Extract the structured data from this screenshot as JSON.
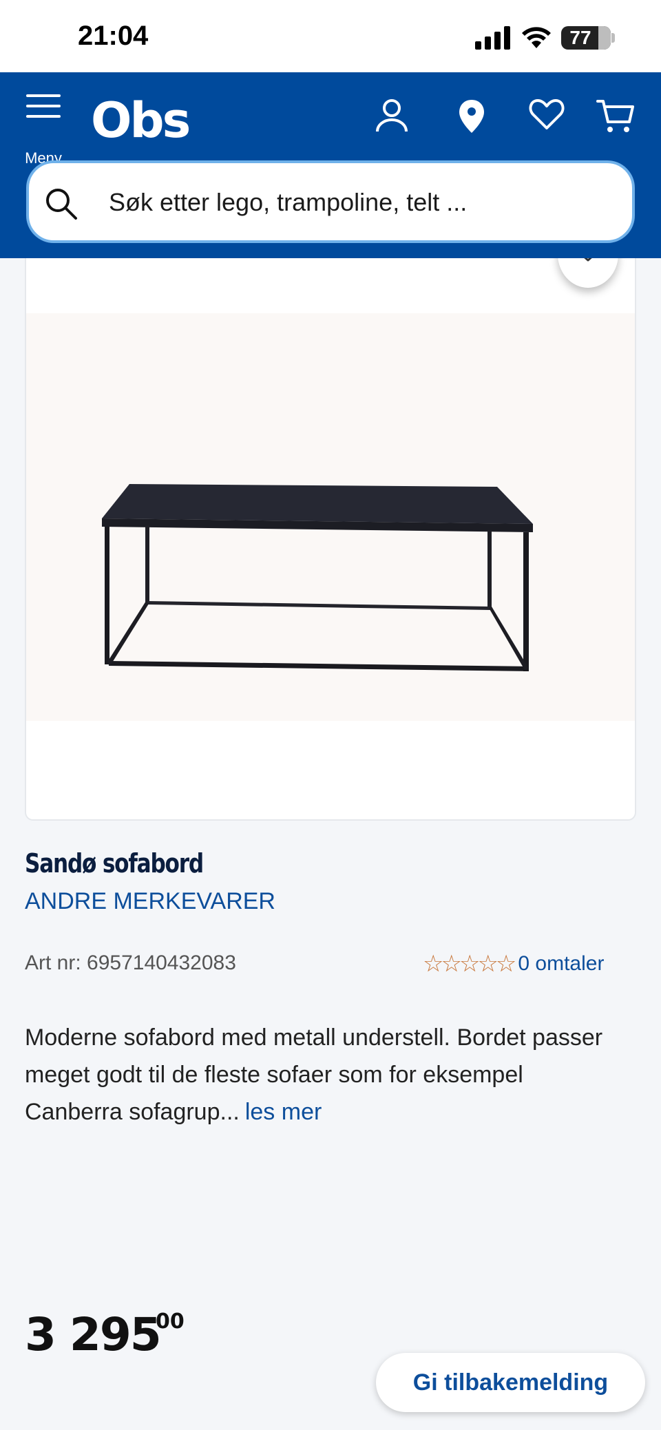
{
  "status_bar": {
    "time": "21:04",
    "battery": "77"
  },
  "header": {
    "menu_label": "Meny",
    "logo_text": "Obs",
    "search_placeholder": "Søk etter lego, trampoline, telt ..."
  },
  "product": {
    "title": "Sandø sofabord",
    "brand": "ANDRE MERKEVARER",
    "art_nr": "Art nr: 6957140432083",
    "rating_stars": "☆☆☆☆☆",
    "rating_value": 0,
    "reviews": "0 omtaler",
    "description": "Moderne sofabord med metall understell. Bordet passer meget godt til de fleste sofaer som for eksempel Canberra sofagrup...",
    "read_more": "les mer",
    "price_main": "3 295",
    "price_cents": "00"
  },
  "feedback_button": "Gi tilbakemelding",
  "colors": {
    "header_bg": "#004a9c",
    "link": "#0d4e9b",
    "title": "#0b1e3f",
    "star": "#c8773b"
  }
}
